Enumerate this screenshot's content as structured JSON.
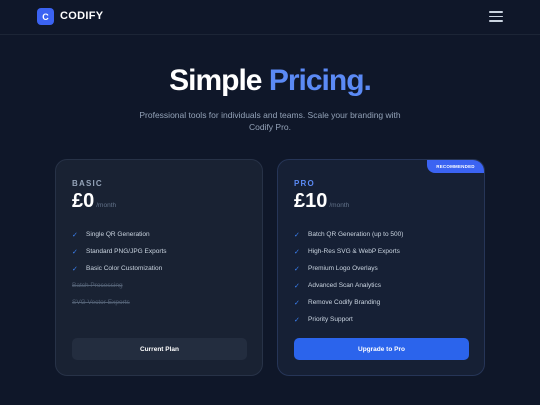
{
  "header": {
    "logo_letter": "C",
    "brand": "CODIFY"
  },
  "hero": {
    "title_part1": "Simple",
    "title_part2": "Pricing.",
    "subtitle": "Professional tools for individuals and teams. Scale your branding with Codify Pro."
  },
  "plans": [
    {
      "name": "BASIC",
      "price": "£0",
      "period": "/month",
      "features": [
        {
          "label": "Single QR Generation",
          "included": true
        },
        {
          "label": "Standard PNG/JPG Exports",
          "included": true
        },
        {
          "label": "Basic Color Customization",
          "included": true
        },
        {
          "label": "Batch Processing",
          "included": false
        },
        {
          "label": "SVG Vector Exports",
          "included": false
        }
      ],
      "cta": "Current Plan"
    },
    {
      "name": "PRO",
      "badge": "RECOMMENDED",
      "price": "£10",
      "period": "/month",
      "features": [
        {
          "label": "Batch QR Generation (up to 500)",
          "included": true
        },
        {
          "label": "High-Res SVG & WebP Exports",
          "included": true
        },
        {
          "label": "Premium Logo Overlays",
          "included": true
        },
        {
          "label": "Advanced Scan Analytics",
          "included": true
        },
        {
          "label": "Remove Codify Branding",
          "included": true
        },
        {
          "label": "Priority Support",
          "included": true
        }
      ],
      "cta": "Upgrade to Pro"
    }
  ],
  "colors": {
    "background": "#0f1729",
    "accent": "#3b63f2",
    "accent_text": "#5b8af5",
    "card_basic": "#192233",
    "card_pro": "#162035"
  },
  "icons": {
    "menu": "hamburger-menu-icon",
    "check": "check-icon"
  }
}
